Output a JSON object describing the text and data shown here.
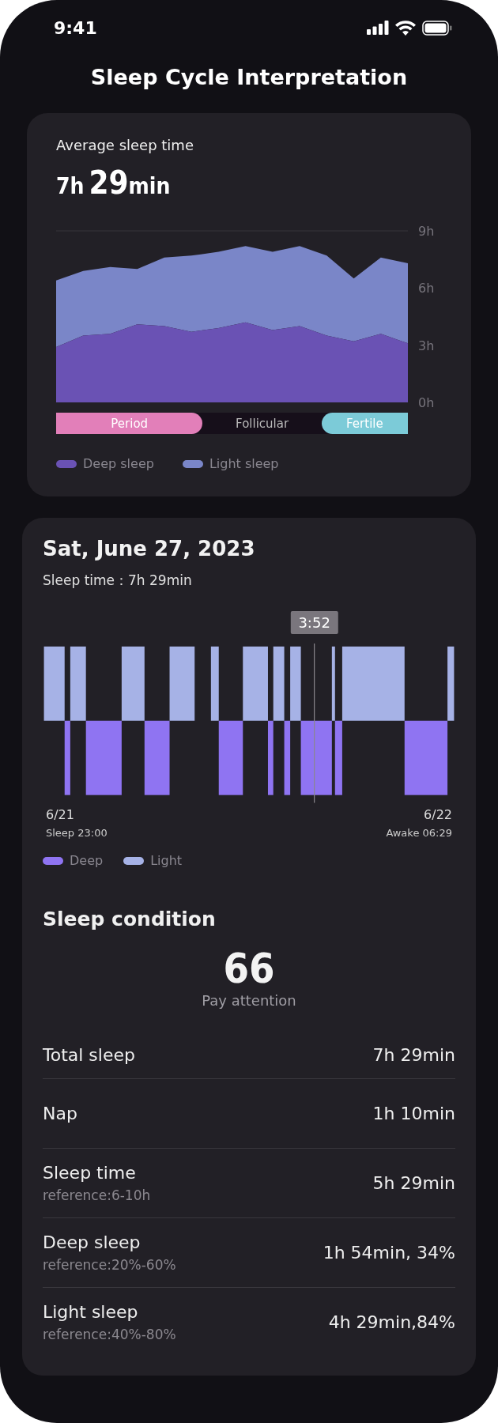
{
  "status_bar": {
    "time": "9:41"
  },
  "title": "Sleep Cycle Interpretation",
  "average_card": {
    "label": "Average sleep time",
    "hours": "7h",
    "minutes": "29",
    "minutes_unit": "min",
    "chart_data": {
      "type": "area",
      "stacked": true,
      "ylim": [
        0,
        9
      ],
      "yticks": [
        {
          "value": 0,
          "label": "0h"
        },
        {
          "value": 3,
          "label": "3h"
        },
        {
          "value": 6,
          "label": "6h"
        },
        {
          "value": 9,
          "label": "9h"
        }
      ],
      "series": [
        {
          "name": "Deep sleep",
          "color": "#6a52b4",
          "values": [
            2.9,
            3.5,
            3.6,
            4.1,
            4.0,
            3.7,
            3.9,
            4.2,
            3.8,
            4.0,
            3.5,
            3.2,
            3.6,
            3.1
          ]
        },
        {
          "name": "Light sleep",
          "color": "#7a86c8",
          "values": [
            3.5,
            3.4,
            3.5,
            2.9,
            3.6,
            4.0,
            4.0,
            4.0,
            4.1,
            4.2,
            4.2,
            3.3,
            4.0,
            4.2
          ]
        }
      ]
    },
    "phases": [
      {
        "label": "Period",
        "color": "#e27fb9"
      },
      {
        "label": "Follicular",
        "color": "#160f1a"
      },
      {
        "label": "Fertile",
        "color": "#7ccbd8"
      }
    ]
  },
  "day_card": {
    "date": "Sat, June 27, 2023",
    "sleep_time": "Sleep time：7h 29min",
    "cursor_time": "3:52",
    "start_date": "6/21",
    "end_date": "6/22",
    "start_label": "Sleep 23:00",
    "end_label": "Awake 06:29",
    "legend": [
      {
        "label": "Deep",
        "color": "#8f74f2"
      },
      {
        "label": "Light",
        "color": "#a6b2e6"
      }
    ],
    "condition_title": "Sleep condition",
    "score": "66",
    "score_label": "Pay attention",
    "rows": [
      {
        "label": "Total sleep",
        "value": "7h 29min"
      },
      {
        "label": "Nap",
        "value": "1h 10min"
      },
      {
        "label": "Sleep time",
        "reference": "reference:6-10h",
        "value": "5h 29min"
      },
      {
        "label": "Deep sleep",
        "reference": "reference:20%-60%",
        "value": "1h 54min, 34%"
      },
      {
        "label": "Light sleep",
        "reference": "reference:40%-80%",
        "value": "4h 29min,84%"
      }
    ]
  }
}
